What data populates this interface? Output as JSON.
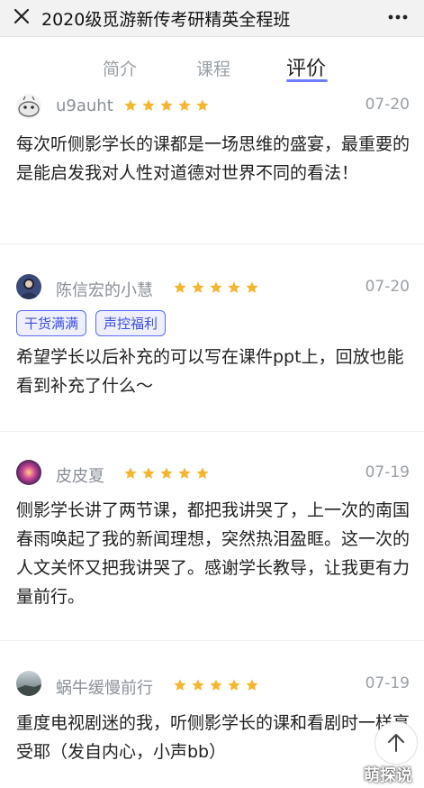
{
  "header": {
    "title": "2020级觅游新传考研精英全程班"
  },
  "tabs": [
    {
      "label": "简介"
    },
    {
      "label": "课程"
    },
    {
      "label": "评价"
    }
  ],
  "reviews": [
    {
      "user": "u9auht",
      "stars": 5,
      "date": "07-20",
      "text": "每次听侧影学长的课都是一场思维的盛宴，最重要的是能启发我对人性对道德对世界不同的看法！"
    },
    {
      "user": "陈信宏的小慧",
      "stars": 5,
      "date": "07-20",
      "tags": [
        "干货满满",
        "声控福利"
      ],
      "text": "希望学长以后补充的可以写在课件ppt上，回放也能看到补充了什么～"
    },
    {
      "user": "皮皮夏",
      "stars": 5,
      "date": "07-19",
      "text": "侧影学长讲了两节课，都把我讲哭了，上一次的南国春雨唤起了我的新闻理想，突然热泪盈眶。这一次的人文关怀又把我讲哭了。感谢学长教导，让我更有力量前行。"
    },
    {
      "user": "蜗牛缓慢前行",
      "stars": 5,
      "date": "07-19",
      "text": "重度电视剧迷的我，听侧影学长的课和看剧时一样享受耶（发自内心，小声bb）"
    }
  ],
  "watermark": "萌探说",
  "colors": {
    "star": "#f5b52e",
    "accent": "#6f7cff"
  }
}
